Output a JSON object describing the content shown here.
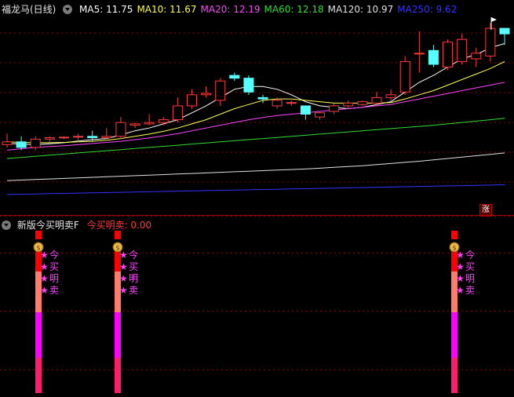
{
  "main_chart": {
    "title": "福龙马(日线)",
    "ma_labels": [
      {
        "text": "MA5: 11.75",
        "color": "#ffffff"
      },
      {
        "text": "MA10: 11.67",
        "color": "#ffff55"
      },
      {
        "text": "MA20: 12.19",
        "color": "#ff44ff"
      },
      {
        "text": "MA60: 12.18",
        "color": "#33dd33"
      },
      {
        "text": "MA120: 10.97",
        "color": "#e0e0e0"
      },
      {
        "text": "MA250: 9.62",
        "color": "#3333ff"
      }
    ],
    "badge": "涨",
    "colors": {
      "up": "#ff3b3b",
      "down": "#55ffff",
      "grid": "#8b0000"
    }
  },
  "indicator": {
    "name": "新版今买明卖F",
    "value_label": "今买明卖: 0.00",
    "signal_labels": [
      "今",
      "买",
      "明",
      "卖"
    ],
    "money_icon": "money-bag-icon",
    "star_icon": "star-icon",
    "colors": {
      "label": "#ff44ff",
      "value": "#ff3b3b",
      "bar_top": "#ff0000",
      "bar_mid": "#ff7b6b",
      "bar_low": "#ff00ff",
      "bar_bottom": "#ff1c6c"
    }
  },
  "chart_data": {
    "type": "candlestick",
    "candles": [
      {
        "o": 11.2,
        "h": 11.6,
        "l": 11.1,
        "c": 11.3
      },
      {
        "o": 11.3,
        "h": 11.5,
        "l": 11.0,
        "c": 11.1
      },
      {
        "o": 11.1,
        "h": 11.5,
        "l": 11.0,
        "c": 11.4
      },
      {
        "o": 11.4,
        "h": 11.5,
        "l": 11.3,
        "c": 11.45
      },
      {
        "o": 11.45,
        "h": 11.5,
        "l": 11.4,
        "c": 11.47
      },
      {
        "o": 11.47,
        "h": 11.6,
        "l": 11.3,
        "c": 11.5
      },
      {
        "o": 11.5,
        "h": 11.7,
        "l": 11.3,
        "c": 11.45
      },
      {
        "o": 11.45,
        "h": 11.8,
        "l": 11.4,
        "c": 11.5
      },
      {
        "o": 11.5,
        "h": 12.2,
        "l": 11.4,
        "c": 12.0
      },
      {
        "o": 11.9,
        "h": 12.0,
        "l": 11.8,
        "c": 11.95
      },
      {
        "o": 11.95,
        "h": 12.3,
        "l": 11.9,
        "c": 12.0
      },
      {
        "o": 12.0,
        "h": 12.2,
        "l": 11.9,
        "c": 12.1
      },
      {
        "o": 12.1,
        "h": 12.9,
        "l": 12.0,
        "c": 12.6
      },
      {
        "o": 12.6,
        "h": 13.2,
        "l": 12.5,
        "c": 13.0
      },
      {
        "o": 13.0,
        "h": 13.3,
        "l": 12.9,
        "c": 13.05
      },
      {
        "o": 12.8,
        "h": 13.6,
        "l": 12.6,
        "c": 13.5
      },
      {
        "o": 13.7,
        "h": 13.8,
        "l": 13.5,
        "c": 13.6
      },
      {
        "o": 13.6,
        "h": 13.7,
        "l": 13.0,
        "c": 13.1
      },
      {
        "o": 12.9,
        "h": 13.0,
        "l": 12.7,
        "c": 12.85
      },
      {
        "o": 12.6,
        "h": 12.9,
        "l": 12.5,
        "c": 12.8
      },
      {
        "o": 12.7,
        "h": 12.8,
        "l": 12.6,
        "c": 12.72
      },
      {
        "o": 12.6,
        "h": 12.6,
        "l": 12.1,
        "c": 12.3
      },
      {
        "o": 12.2,
        "h": 12.4,
        "l": 12.1,
        "c": 12.35
      },
      {
        "o": 12.4,
        "h": 12.7,
        "l": 12.3,
        "c": 12.6
      },
      {
        "o": 12.6,
        "h": 12.8,
        "l": 12.5,
        "c": 12.7
      },
      {
        "o": 12.65,
        "h": 12.8,
        "l": 12.6,
        "c": 12.75
      },
      {
        "o": 12.7,
        "h": 13.1,
        "l": 12.6,
        "c": 12.9
      },
      {
        "o": 12.9,
        "h": 13.2,
        "l": 12.8,
        "c": 13.0
      },
      {
        "o": 13.1,
        "h": 14.4,
        "l": 13.0,
        "c": 14.2
      },
      {
        "o": 14.5,
        "h": 15.3,
        "l": 13.8,
        "c": 14.5
      },
      {
        "o": 14.6,
        "h": 14.8,
        "l": 14.0,
        "c": 14.1
      },
      {
        "o": 14.0,
        "h": 15.0,
        "l": 13.9,
        "c": 14.9
      },
      {
        "o": 14.2,
        "h": 15.2,
        "l": 14.1,
        "c": 15.0
      },
      {
        "o": 14.3,
        "h": 14.7,
        "l": 14.0,
        "c": 14.5
      },
      {
        "o": 14.4,
        "h": 15.6,
        "l": 14.2,
        "c": 15.4
      },
      {
        "o": 15.4,
        "h": 15.4,
        "l": 14.8,
        "c": 15.2
      }
    ],
    "ma": {
      "MA5": {
        "color": "#ffffff",
        "values": [
          11.25,
          11.22,
          11.2,
          11.23,
          11.27,
          11.33,
          11.38,
          11.42,
          11.55,
          11.7,
          11.8,
          11.95,
          12.1,
          12.35,
          12.6,
          12.9,
          13.2,
          13.3,
          13.3,
          13.2,
          13.0,
          12.75,
          12.6,
          12.55,
          12.5,
          12.55,
          12.65,
          12.75,
          13.1,
          13.45,
          13.7,
          14.0,
          14.3,
          14.45,
          14.7,
          14.85
        ]
      },
      "MA10": {
        "color": "#ffff55",
        "values": [
          11.3,
          11.28,
          11.27,
          11.27,
          11.28,
          11.3,
          11.32,
          11.36,
          11.42,
          11.5,
          11.58,
          11.68,
          11.8,
          11.95,
          12.1,
          12.3,
          12.5,
          12.65,
          12.8,
          12.85,
          12.85,
          12.8,
          12.75,
          12.7,
          12.7,
          12.7,
          12.7,
          12.72,
          12.85,
          13.0,
          13.15,
          13.35,
          13.55,
          13.75,
          13.95,
          14.2
        ]
      },
      "MA20": {
        "color": "#ff44ff",
        "values": [
          11.0,
          11.05,
          11.1,
          11.13,
          11.16,
          11.2,
          11.24,
          11.28,
          11.32,
          11.38,
          11.44,
          11.52,
          11.6,
          11.7,
          11.8,
          11.9,
          12.0,
          12.1,
          12.18,
          12.25,
          12.3,
          12.35,
          12.4,
          12.45,
          12.5,
          12.55,
          12.6,
          12.65,
          12.75,
          12.85,
          12.95,
          13.05,
          13.15,
          13.25,
          13.35,
          13.45
        ]
      },
      "MA60": {
        "color": "#33dd33",
        "values": [
          10.7,
          10.74,
          10.78,
          10.82,
          10.86,
          10.9,
          10.94,
          10.98,
          11.02,
          11.06,
          11.1,
          11.14,
          11.18,
          11.22,
          11.26,
          11.3,
          11.34,
          11.38,
          11.42,
          11.46,
          11.5,
          11.54,
          11.58,
          11.62,
          11.66,
          11.7,
          11.74,
          11.78,
          11.82,
          11.86,
          11.9,
          11.95,
          12.0,
          12.05,
          12.1,
          12.15
        ]
      },
      "MA120": {
        "color": "#e0e0e0",
        "values": [
          9.9,
          9.92,
          9.94,
          9.96,
          9.98,
          10.0,
          10.02,
          10.04,
          10.06,
          10.08,
          10.1,
          10.12,
          10.14,
          10.16,
          10.18,
          10.2,
          10.22,
          10.24,
          10.26,
          10.28,
          10.3,
          10.32,
          10.35,
          10.38,
          10.41,
          10.44,
          10.48,
          10.52,
          10.56,
          10.6,
          10.65,
          10.7,
          10.75,
          10.8,
          10.85,
          10.9
        ]
      },
      "MA250": {
        "color": "#3333ff",
        "values": [
          9.4,
          9.41,
          9.42,
          9.43,
          9.44,
          9.45,
          9.46,
          9.47,
          9.48,
          9.49,
          9.5,
          9.51,
          9.52,
          9.53,
          9.54,
          9.55,
          9.56,
          9.57,
          9.58,
          9.59,
          9.6,
          9.61,
          9.62,
          9.63,
          9.64,
          9.65,
          9.66,
          9.67,
          9.68,
          9.69,
          9.7,
          9.71,
          9.72,
          9.73,
          9.74,
          9.75
        ]
      }
    },
    "ylim": [
      9.0,
      15.8
    ],
    "signal_bars_at_candle": [
      2,
      7,
      28
    ]
  }
}
